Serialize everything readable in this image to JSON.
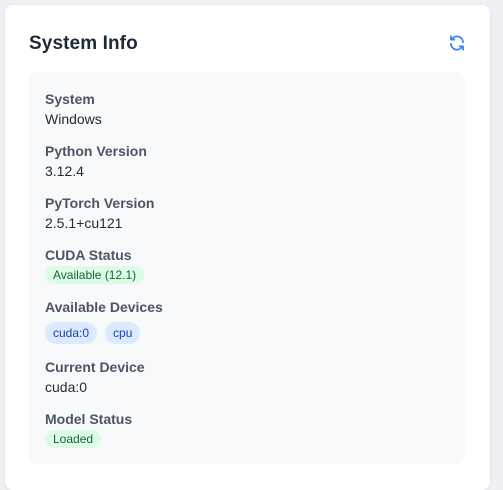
{
  "header": {
    "title": "System Info",
    "refresh_icon": "refresh-icon",
    "accent_color": "#3b82f6"
  },
  "info": {
    "system": {
      "label": "System",
      "value": "Windows"
    },
    "python": {
      "label": "Python Version",
      "value": "3.12.4"
    },
    "pytorch": {
      "label": "PyTorch Version",
      "value": "2.5.1+cu121"
    },
    "cuda": {
      "label": "CUDA Status",
      "value": "Available (12.1)"
    },
    "devices": {
      "label": "Available Devices",
      "items": [
        "cuda:0",
        "cpu"
      ]
    },
    "current_device": {
      "label": "Current Device",
      "value": "cuda:0"
    },
    "model": {
      "label": "Model Status",
      "value": "Loaded"
    }
  },
  "colors": {
    "success_bg": "#dcfce7",
    "success_text": "#166534",
    "device_bg": "#dbeafe",
    "device_text": "#1e40af"
  }
}
